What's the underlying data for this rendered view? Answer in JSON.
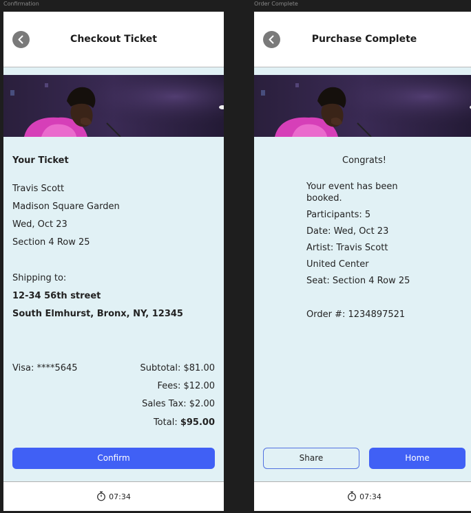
{
  "frames": {
    "left_label": "Confirmation",
    "right_label": "Order Complete"
  },
  "checkout": {
    "title": "Checkout Ticket",
    "section_heading": "Your Ticket",
    "artist": "Travis Scott",
    "venue": "Madison Square Garden",
    "date": "Wed, Oct 23",
    "seat": "Section 4 Row 25",
    "shipping_label": "Shipping to:",
    "address_line1": "12-34 56th street",
    "address_line2": "South Elmhurst, Bronx, NY, 12345",
    "payment": "Visa: ****5645",
    "subtotal": "Subtotal: $81.00",
    "fees": "Fees: $12.00",
    "sales_tax": "Sales Tax: $2.00",
    "total_label": "Total: ",
    "total_value": "$95.00",
    "confirm_label": "Confirm",
    "timer": "07:34"
  },
  "complete": {
    "title": "Purchase Complete",
    "congrats": "Congrats!",
    "message_line1": "Your event has been",
    "message_line2": "booked.",
    "participants": "Participants: 5",
    "date_label": "Date: ",
    "date_value": "Wed, Oct 23",
    "artist_label": "Artist: ",
    "artist_value": "Travis Scott",
    "venue": "United Center",
    "seat_label": "Seat: ",
    "seat_value": "Section 4 Row 25",
    "order_number": "Order #: 1234897521",
    "share_label": "Share",
    "home_label": "Home",
    "timer": "07:34"
  },
  "icons": {
    "back": "chevron-left-icon",
    "timer": "stopwatch-icon"
  },
  "colors": {
    "accent": "#4060f5",
    "panel_background": "#e1f1f5",
    "canvas": "#1e1e1e"
  }
}
